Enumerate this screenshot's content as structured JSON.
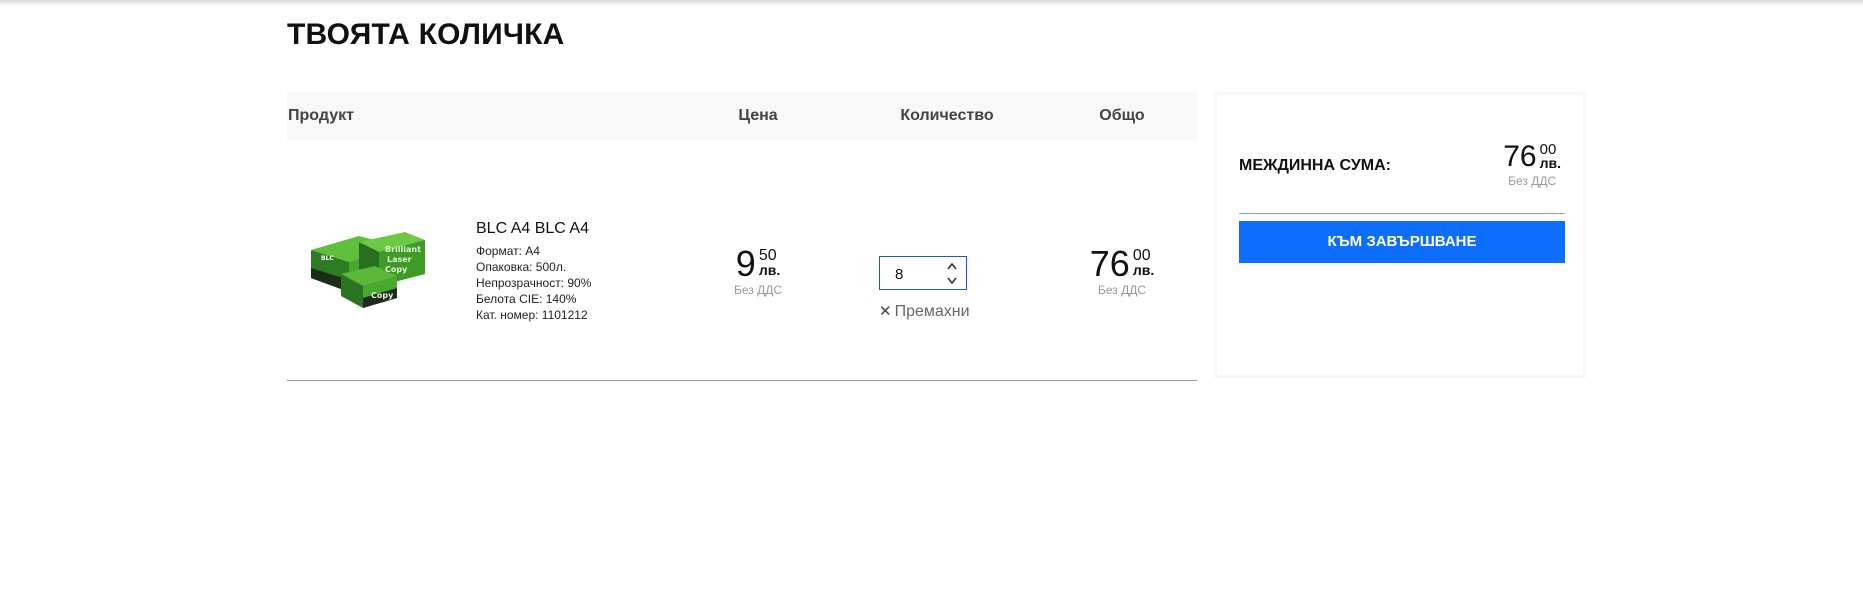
{
  "page": {
    "title": "ТВОЯТА КОЛИЧКА"
  },
  "table": {
    "headers": {
      "product": "Продукт",
      "price": "Цена",
      "quantity": "Количество",
      "total": "Общо"
    },
    "items": [
      {
        "name": "BLC A4 BLC A4",
        "specs": [
          "Формат: А4",
          "Опаковка: 500л.",
          "Непрозрачност: 90%",
          "Белота CIE: 140%",
          "Кат. номер: 1101212"
        ],
        "image_icon": "paper-box-product-image",
        "unit_price": {
          "integer": "9",
          "decimal": "50",
          "currency": "лв.",
          "note": "Без ДДС"
        },
        "quantity": "8",
        "remove_label": "Премахни",
        "line_total": {
          "integer": "76",
          "decimal": "00",
          "currency": "лв.",
          "note": "Без ДДС"
        }
      }
    ]
  },
  "summary": {
    "subtotal_label": "МЕЖДИННА СУМА:",
    "subtotal": {
      "integer": "76",
      "decimal": "00",
      "currency": "лв.",
      "note": "Без ДДС"
    },
    "checkout_label": "КЪМ ЗАВЪРШВАНЕ"
  },
  "colors": {
    "accent": "#0d6efd",
    "header_bg": "#f8f8f8",
    "muted_text": "#999999"
  }
}
